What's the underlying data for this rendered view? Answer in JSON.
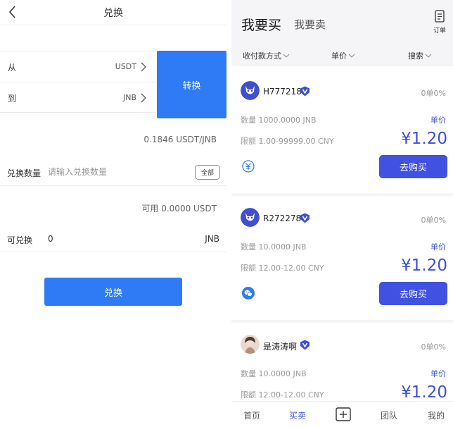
{
  "exchange": {
    "title": "兑换",
    "from_label": "从",
    "from_value": "USDT",
    "to_label": "到",
    "to_value": "JNB",
    "swap_button": "转换",
    "rate": "0.1846 USDT/JNB",
    "qty_label": "兑换数量",
    "qty_placeholder": "请输入兑换数量",
    "all_button": "全部",
    "available": "可用 0.0000 USDT",
    "convertible_label": "可兑换",
    "convertible_value": "0",
    "convertible_unit": "JNB",
    "submit_button": "兑换"
  },
  "market": {
    "tab_buy": "我要买",
    "tab_sell": "我要卖",
    "orders_label": "订单",
    "filters": [
      "收付款方式",
      "单价",
      "搜索"
    ],
    "colors": {
      "accent": "#3c4fd8",
      "button": "#4151e2",
      "primary_blue": "#2f7bf5"
    },
    "cards": [
      {
        "name": "H777218",
        "stats": "0单0%",
        "quantity": "数量 1000.0000 JNB",
        "unit_label": "单价",
        "limit": "限额 1.00-99999.00 CNY",
        "price": "¥1.20",
        "pay_icon": "yuan-icon",
        "buy_button": "去购买"
      },
      {
        "name": "R272278",
        "stats": "0单0%",
        "quantity": "数量 10.0000 JNB",
        "unit_label": "单价",
        "limit": "限额 12.00-12.00 CNY",
        "price": "¥1.20",
        "pay_icon": "wechat-icon",
        "buy_button": "去购买"
      },
      {
        "name": "是涛涛啊",
        "stats": "0单0%",
        "quantity": "数量 10.0000 JNB",
        "unit_label": "单价",
        "limit": "限额 12.00-12.00 CNY",
        "price": "¥1.20"
      }
    ],
    "nav": [
      "首页",
      "买卖",
      "团队",
      "我的"
    ]
  }
}
